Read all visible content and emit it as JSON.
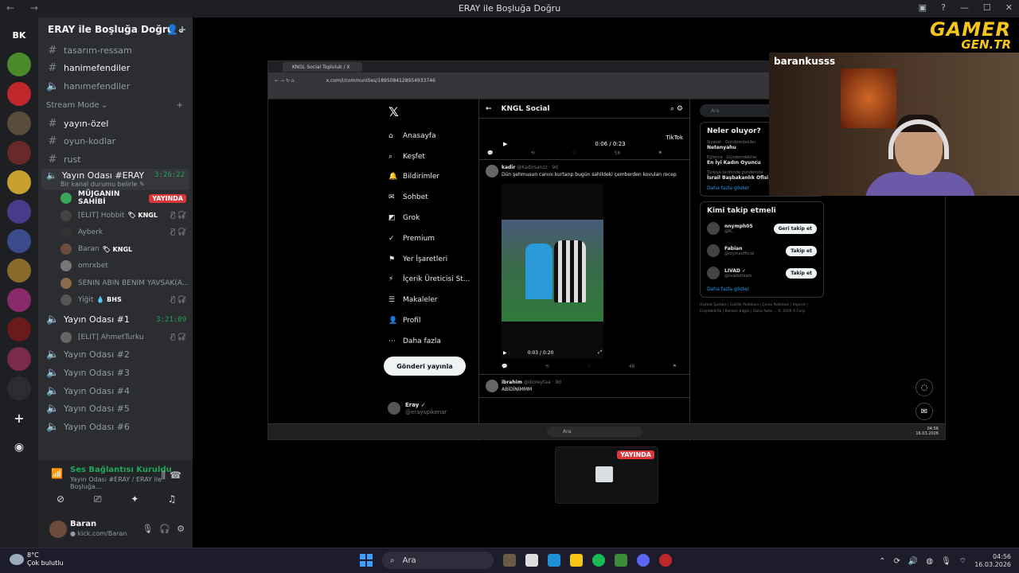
{
  "window": {
    "title": "ERAY ile Boşluğa Doğru",
    "nav": "← →"
  },
  "server_rail": {
    "bk_label": "BK"
  },
  "guild": {
    "name": "ERAY ile Boşluğa Doğru"
  },
  "channels": [
    {
      "name": "tasarım-ressam",
      "type": "text"
    },
    {
      "name": "hanimefendiler",
      "type": "text",
      "bright": true
    },
    {
      "name": "hanımefendiler",
      "type": "voice"
    }
  ],
  "category": {
    "name": "Stream Mode",
    "plus": "+"
  },
  "stream_channels": [
    {
      "name": "yayın-özel",
      "bright": true
    },
    {
      "name": "oyun-kodlar"
    },
    {
      "name": "rust"
    }
  ],
  "active_voice": {
    "name": "Yayın Odası #ERAY",
    "time": "3:26:22",
    "status": "Bir kanal durumu belirle ✎",
    "users": [
      {
        "name": "MÜJGANIN SAHİBİ",
        "live": "YAYINDA",
        "white": true
      },
      {
        "name": "[ELIT] Hobbit",
        "tag": "🏷 KNGL",
        "mutes": "🎙̸ 🎧̸"
      },
      {
        "name": "Ayberk",
        "mutes": "🎙̸ 🎧̸"
      },
      {
        "name": "Baran",
        "tag": "🏷 KNGL"
      },
      {
        "name": "omrxbet"
      },
      {
        "name": "SENIN ABIN BENIM YAVSAK(A...",
        "mutes": ""
      },
      {
        "name": "Yiğit",
        "tag": "💧 BHS",
        "mutes": "🎙̸ 🎧̸"
      }
    ]
  },
  "voice1": {
    "name": "Yayın Odası #1",
    "time": "3:21:09",
    "users": [
      {
        "name": "[ELIT] AhmetTurku",
        "mutes": "🎙̸ 🎧̸"
      }
    ]
  },
  "voice_rooms": [
    "Yayın Odası #2",
    "Yayın Odası #3",
    "Yayın Odası #4",
    "Yayın Odası #5",
    "Yayın Odası #6"
  ],
  "voice_panel": {
    "status": "Ses Bağlantısı Kuruldu",
    "sub": "Yayın Odası #ERAY / ERAY ile Boşluğa..."
  },
  "user_panel": {
    "name": "Baran",
    "status": "● kick.com/Baran"
  },
  "logo": {
    "line1": "GAMER",
    "line2": "GEN.TR"
  },
  "browser": {
    "tab": "KNGL Social Topluluk / X",
    "url": "x.com/i/communities/1895084128954933746"
  },
  "x_nav": {
    "logo": "𝕏",
    "items": [
      {
        "icon": "⌂",
        "label": "Anasayfa"
      },
      {
        "icon": "⌕",
        "label": "Keşfet"
      },
      {
        "icon": "🔔",
        "label": "Bildirimler"
      },
      {
        "icon": "✉",
        "label": "Sohbet"
      },
      {
        "icon": "◩",
        "label": "Grok"
      },
      {
        "icon": "✓",
        "label": "Premium"
      },
      {
        "icon": "⚑",
        "label": "Yer İşaretleri"
      },
      {
        "icon": "⚡",
        "label": "İçerik Üreticisi St..."
      },
      {
        "icon": "☰",
        "label": "Makaleler"
      },
      {
        "icon": "👤",
        "label": "Profil"
      },
      {
        "icon": "⋯",
        "label": "Daha fazla"
      }
    ],
    "post_button": "Gönderi yayınla",
    "user_name": "Eray ✓",
    "user_handle": "@erayspikenar"
  },
  "feed": {
    "title": "KNGL Social",
    "top_video": {
      "time": "0:06 / 0:23",
      "watermark": "TikTok",
      "views": "56"
    },
    "post1": {
      "author": "kadir",
      "handle": "@Kadirsanzz · 9d",
      "text": "Dün şehmusun canını kurtarıp bugün sahildeki çemberden kovulan recep",
      "time": "0:03 / 0:20",
      "views": "48"
    },
    "post2": {
      "author": "ibrahim",
      "handle": "@iboleytaa · 9d",
      "text": "ABİDİNİMMM"
    }
  },
  "right_side": {
    "search": "Ara",
    "trends_title": "Neler oluyor?",
    "trends": [
      {
        "cat": "Siyaset · Gündemdekiler",
        "topic": "Netenyahu"
      },
      {
        "cat": "Eğlence · Gündemdekiler",
        "topic": "En İyi Kadın Oyuncu"
      },
      {
        "cat": "Türkiye tarihinde gündemde",
        "topic": "İsrail Başbakanlık Ofisi"
      }
    ],
    "show_more": "Daha fazla göster",
    "follow_title": "Kimi takip etmeli",
    "follow": [
      {
        "name": "nnymph05",
        "handle": "@N...",
        "button": "Geri takip et"
      },
      {
        "name": "Fabian",
        "handle": "@crymaofficial",
        "button": "Takip et"
      },
      {
        "name": "LIVAD ✓",
        "handle": "@livadstream",
        "button": "Takip et"
      }
    ],
    "footer": "Hizmet Şartları | Gizlilik Politikası | Çerez Politikası | Imprint | Erişilebilirlik | Reklam bilgisi | Daha fazla ... © 2026 X Corp."
  },
  "browser_taskbar": {
    "search": "Ara",
    "time": "04:56",
    "date": "16.03.2026"
  },
  "webcam": {
    "username": "barankusss"
  },
  "mini_preview": {
    "live": "YAYINDA"
  },
  "taskbar": {
    "temp": "8°C",
    "weather": "Çok bulutlu",
    "search": "Ara",
    "time": "04:56",
    "date": "16.03.2026"
  }
}
